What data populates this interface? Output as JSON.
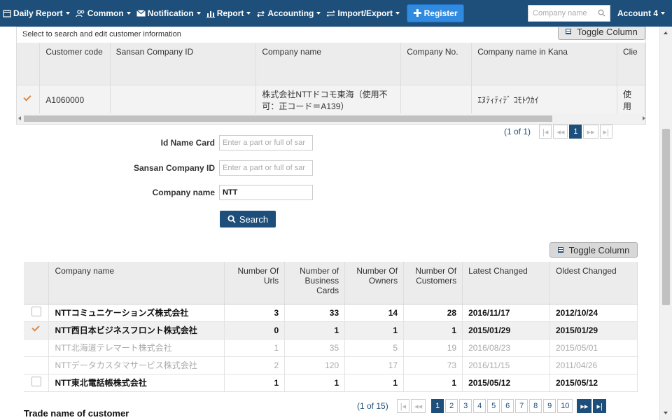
{
  "nav": {
    "items": [
      {
        "label": "Daily Report",
        "icon": "calendar-icon"
      },
      {
        "label": "Common",
        "icon": "users-icon"
      },
      {
        "label": "Notification",
        "icon": "envelope-icon"
      },
      {
        "label": "Report",
        "icon": "bar-chart-icon"
      },
      {
        "label": "Accounting",
        "icon": "exchange-icon"
      },
      {
        "label": "Import/Export",
        "icon": "swap-icon"
      }
    ],
    "register_label": "Register",
    "search_placeholder": "Company name",
    "account_label": "Account 4"
  },
  "customer_panel": {
    "caption": "Select to search and edit customer information",
    "toggle_label": "Toggle Column",
    "headers": [
      "",
      "Customer code",
      "Sansan Company ID",
      "Company name",
      "Company No.",
      "Company name in Kana",
      "Clie"
    ],
    "rows": [
      {
        "checked": true,
        "code": "A1060000",
        "sansan_id": "",
        "company_name": "株式会社NTTドコモ東海（使用不可：正コード＝A139）",
        "company_no": "",
        "kana": "ｴﾇﾃｨﾃｨﾃﾞ ｺﾓﾄｳｶｲ",
        "client": "使用"
      }
    ],
    "pager": {
      "info": "(1 of 1)",
      "pages": [
        "1"
      ],
      "active": "1"
    }
  },
  "search_form": {
    "id_name_card": {
      "label": "Id Name Card",
      "placeholder": "Enter a part or full of sar",
      "value": ""
    },
    "sansan_company_id": {
      "label": "Sansan Company ID",
      "placeholder": "Enter a part or full of sar",
      "value": ""
    },
    "company_name": {
      "label": "Company name",
      "value": "NTT"
    },
    "search_label": "Search"
  },
  "results": {
    "toggle_label": "Toggle Column",
    "headers": {
      "company_name": "Company name",
      "urls": "Number Of Urls",
      "business_cards": "Number of Business Cards",
      "owners": "Number Of Owners",
      "customers": "Number Of Customers",
      "latest": "Latest Changed",
      "oldest": "Oldest Changed"
    },
    "rows": [
      {
        "check": "box",
        "style": "bold",
        "name": "NTTコミュニケーションズ株式会社",
        "urls": "3",
        "cards": "33",
        "owners": "14",
        "customers": "28",
        "latest": "2016/11/17",
        "oldest": "2012/10/24"
      },
      {
        "check": "on",
        "style": "bold sel",
        "name": "NTT西日本ビジネスフロント株式会社",
        "urls": "0",
        "cards": "1",
        "owners": "1",
        "customers": "1",
        "latest": "2015/01/29",
        "oldest": "2015/01/29"
      },
      {
        "check": "none",
        "style": "dim",
        "name": "NTT北海道テレマート株式会社",
        "urls": "1",
        "cards": "35",
        "owners": "5",
        "customers": "19",
        "latest": "2016/08/23",
        "oldest": "2015/05/01"
      },
      {
        "check": "none",
        "style": "dim",
        "name": "NTTデータカスタマサービス株式会社",
        "urls": "2",
        "cards": "120",
        "owners": "17",
        "customers": "73",
        "latest": "2016/11/15",
        "oldest": "2011/04/26"
      },
      {
        "check": "box",
        "style": "bold",
        "name": "NTT東北電話帳株式会社",
        "urls": "1",
        "cards": "1",
        "owners": "1",
        "customers": "1",
        "latest": "2015/05/12",
        "oldest": "2015/05/12"
      }
    ],
    "pager": {
      "info": "(1 of 15)",
      "pages": [
        "1",
        "2",
        "3",
        "4",
        "5",
        "6",
        "7",
        "8",
        "9",
        "10"
      ],
      "active": "1"
    }
  },
  "trade_name_label": "Trade name of customer",
  "colors": {
    "navbar": "#1d4f7a",
    "accent": "#2f8ae0",
    "check": "#d9894a"
  }
}
